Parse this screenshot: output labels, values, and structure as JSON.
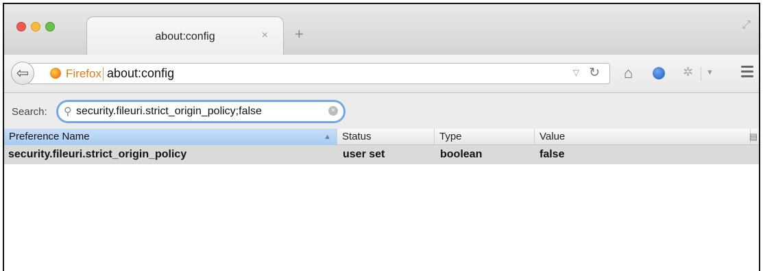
{
  "tab": {
    "title": "about:config",
    "close": "×",
    "new_tab": "+"
  },
  "navbar": {
    "identity_label": "Firefox",
    "url": "about:config"
  },
  "search": {
    "label": "Search:",
    "value": "security.fileuri.strict_origin_policy;false"
  },
  "table": {
    "columns": [
      "Preference Name",
      "Status",
      "Type",
      "Value"
    ],
    "rows": [
      {
        "name": "security.fileuri.strict_origin_policy",
        "status": "user set",
        "type": "boolean",
        "value": "false"
      }
    ]
  },
  "colors": {
    "accent": "#6fa7ea",
    "firefox_orange": "#e07b16",
    "selected_row": "#dadada"
  }
}
